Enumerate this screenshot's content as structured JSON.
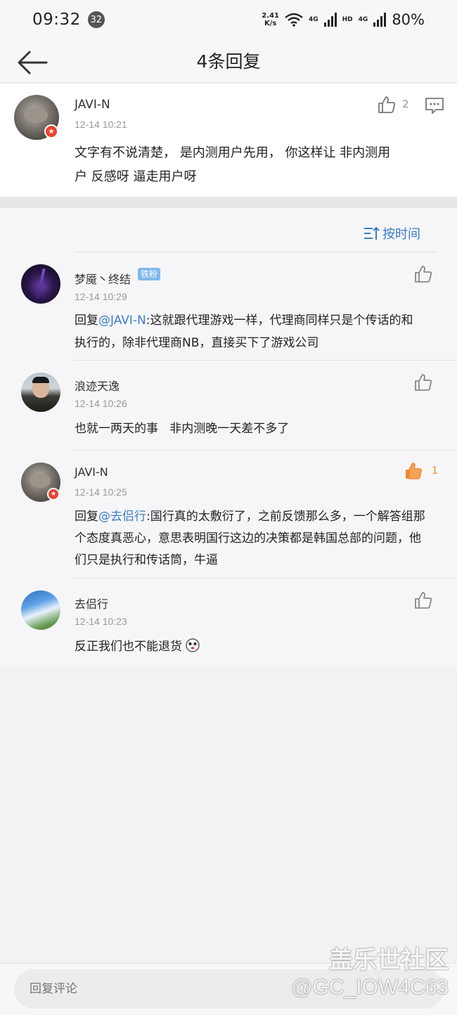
{
  "status_bar": {
    "time": "09:32",
    "notification_count": "32",
    "net_speed_value": "2.41",
    "net_speed_unit": "K/s",
    "net_label_1": "4G",
    "hd_label": "HD",
    "net_label_2": "4G",
    "battery": "80%"
  },
  "header": {
    "title": "4条回复"
  },
  "main_comment": {
    "username": "JAVI-N",
    "timestamp": "12-14 10:21",
    "like_count": "2",
    "text_line1": "文字有不说清楚， 是内测用户先用， 你这样让 非内测用",
    "text_line2": "户 反感呀 逼走用户呀"
  },
  "sort": {
    "label": "按时间"
  },
  "replies": [
    {
      "username": "梦魇丶终结",
      "badge": "铁粉",
      "timestamp": "12-14 10:29",
      "reply_prefix": "回复",
      "mention": "@JAVI-N",
      "text_first": ":这就跟代理游戏一样，代理商同样只是个传话的和",
      "text_lines": [
        "执行的，除非代理商NB，直接买下了游戏公司"
      ],
      "liked": false,
      "like_count": ""
    },
    {
      "username": "浪迹天逸",
      "timestamp": "12-14 10:26",
      "text_lines": [
        "也就一两天的事   非内测晚一天差不多了"
      ],
      "liked": false,
      "like_count": ""
    },
    {
      "username": "JAVI-N",
      "timestamp": "12-14 10:25",
      "reply_prefix": "回复",
      "mention": "@去侣行",
      "text_first": ":国行真的太敷衍了，之前反馈那么多，一个解答组那",
      "text_lines": [
        "个态度真恶心，意思表明国行这边的决策都是韩国总部的问题，他",
        "们只是执行和传话筒，牛逼"
      ],
      "liked": true,
      "like_count": "1"
    },
    {
      "username": "去侣行",
      "timestamp": "12-14 10:23",
      "text_lines": [
        "反正我们也不能退货"
      ],
      "liked": false,
      "like_count": ""
    }
  ],
  "bottom_bar": {
    "placeholder": "回复评论"
  },
  "watermark": {
    "line1": "盖乐世社区",
    "line2": "@GC_IOW4C63"
  },
  "colors": {
    "accent_blue": "#3a7dc9",
    "liked_orange": "#f08a2c",
    "rank_red": "#e8442f"
  }
}
